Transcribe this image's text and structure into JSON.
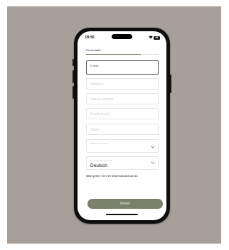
{
  "status_bar": {
    "time": "09:56",
    "wifi_icon": "wifi-icon",
    "battery_level": "66"
  },
  "section": {
    "title": "Personalien",
    "progress_percent": 75
  },
  "fields": {
    "email": {
      "label": "E-Mail"
    },
    "street": {
      "placeholder": "Strasse"
    },
    "house_number": {
      "placeholder": "Hausnummer"
    },
    "postal_code": {
      "placeholder": "Postleitzahl"
    },
    "city": {
      "placeholder": "Stadt"
    },
    "second_nationality": {
      "label": "Zweite Nationalität",
      "icon": "chevron-down-icon"
    },
    "correspondence_language": {
      "label": "Korrespondenzsprache",
      "value": "Deutsch",
      "icon": "chevron-down-icon"
    }
  },
  "hint": "Bitte geben Sie Ihre Wohnsitzadresse an.",
  "buttons": {
    "next": "Weiter"
  },
  "colors": {
    "backdrop": "#a79f99",
    "accent_button": "#7a8069",
    "progress": "#6f7b5f"
  }
}
